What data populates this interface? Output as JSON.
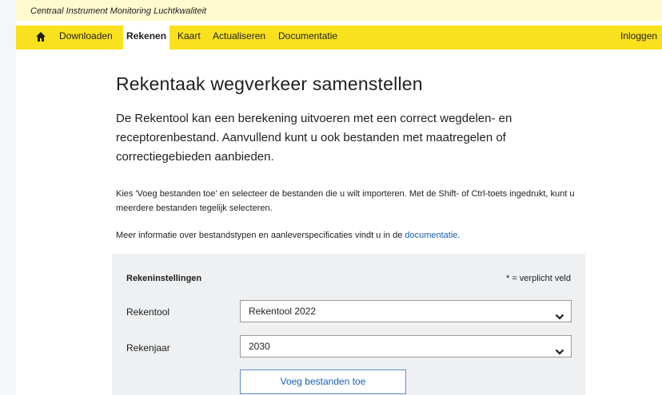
{
  "topbar": {
    "title": "Centraal Instrument Monitoring Luchtkwaliteit"
  },
  "nav": {
    "items": [
      {
        "label": "Downloaden"
      },
      {
        "label": "Rekenen"
      },
      {
        "label": "Kaart"
      },
      {
        "label": "Actualiseren"
      },
      {
        "label": "Documentatie"
      }
    ],
    "login": "Inloggen",
    "accent": "#f9e11e"
  },
  "main": {
    "title": "Rekentaak wegverkeer samenstellen",
    "lead": "De Rekentool kan een berekening uitvoeren met een correct wegdelen- en receptorenbestand. Aanvullend kunt u ook bestanden met maatregelen of correctiegebieden aanbieden.",
    "para1": "Kies 'Voeg bestanden toe' en selecteer de bestanden die u wilt importeren. Met de Shift- of Ctrl-toets ingedrukt, kunt u meerdere bestanden tegelijk selecteren.",
    "para2_prefix": "Meer informatie over bestandstypen en aanleverspecificaties vindt u in de ",
    "para2_link": "documentatie",
    "para2_suffix": "."
  },
  "panel": {
    "title": "Rekeninstellingen",
    "note": "* = verplicht veld",
    "fields": [
      {
        "label": "Rekentool",
        "value": "Rekentool 2022"
      },
      {
        "label": "Rekenjaar",
        "value": "2030"
      }
    ],
    "button": "Voeg bestanden toe"
  }
}
